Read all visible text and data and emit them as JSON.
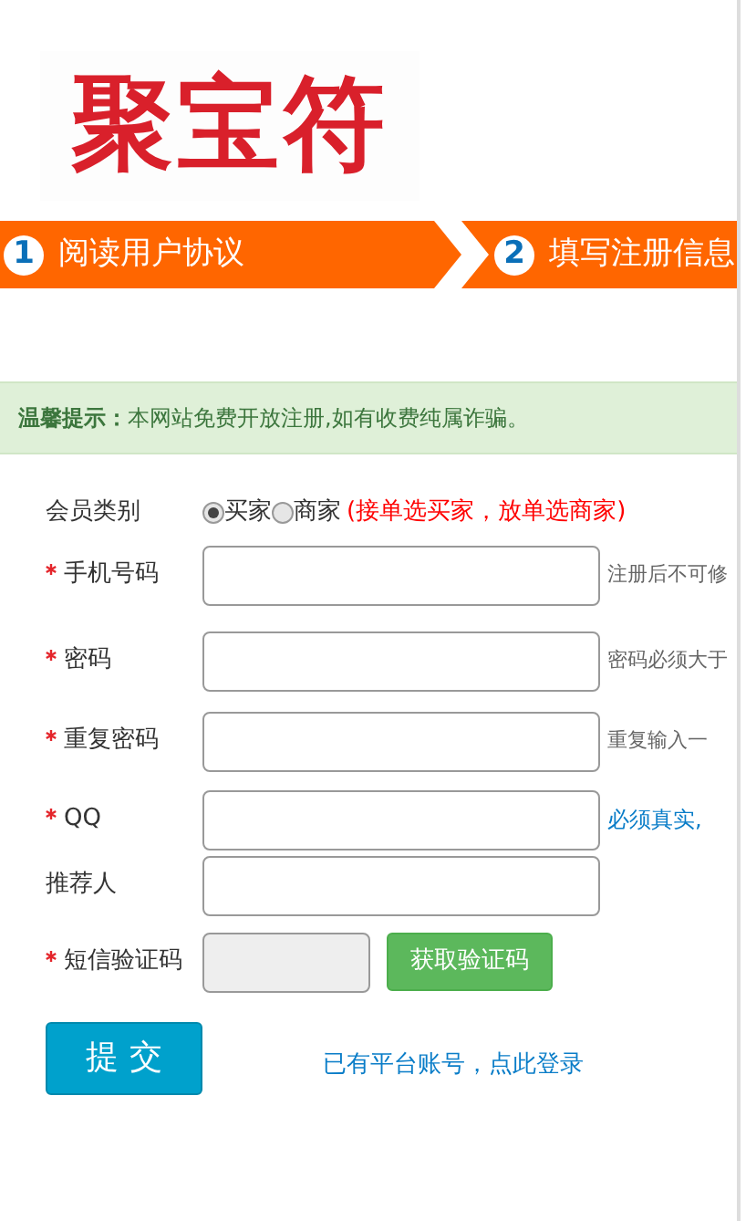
{
  "logo": "聚宝符",
  "steps": [
    {
      "number": "1",
      "label": "阅读用户协议"
    },
    {
      "number": "2",
      "label": "填写注册信息"
    }
  ],
  "notice": {
    "title": "温馨提示：",
    "text": "本网站免费开放注册,如有收费纯属诈骗。"
  },
  "member_type": {
    "label": "会员类别",
    "options": [
      {
        "label": "买家",
        "selected": true
      },
      {
        "label": "商家",
        "selected": false
      }
    ],
    "note": "(接单选买家，放单选商家)"
  },
  "fields": [
    {
      "label": "手机号码",
      "required": true,
      "hint": "注册后不可修",
      "kind": "plain"
    },
    {
      "label": "密码",
      "required": true,
      "hint": "密码必须大于",
      "kind": "plain"
    },
    {
      "label": "重复密码",
      "required": true,
      "hint": "重复输入一",
      "kind": "plain"
    },
    {
      "label": "QQ",
      "required": true,
      "hint": "必须真实,",
      "kind": "link"
    },
    {
      "label": "推荐人",
      "required": false
    }
  ],
  "sms": {
    "label": "短信验证码",
    "required": true,
    "disabled": true,
    "button": "获取验证码"
  },
  "submit": "提 交",
  "login_link": "已有平台账号，点此登录"
}
